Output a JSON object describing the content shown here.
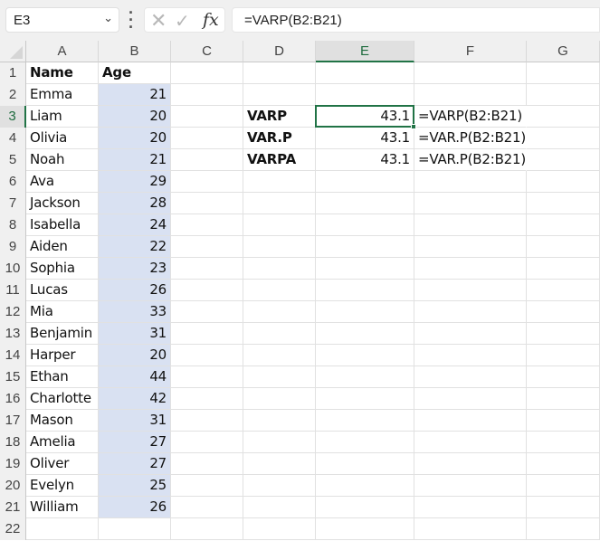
{
  "formula_bar": {
    "name_box": "E3",
    "formula": "=VARP(B2:B21)",
    "icons": [
      "chevron-down-icon",
      "more-options-icon",
      "cancel-icon",
      "enter-icon",
      "insert-function-icon"
    ]
  },
  "columns": [
    "A",
    "B",
    "C",
    "D",
    "E",
    "F",
    "G"
  ],
  "selected_column": "E",
  "selected_row": 3,
  "rows": [
    1,
    2,
    3,
    4,
    5,
    6,
    7,
    8,
    9,
    10,
    11,
    12,
    13,
    14,
    15,
    16,
    17,
    18,
    19,
    20,
    21,
    22
  ],
  "headers": {
    "name": "Name",
    "age": "Age"
  },
  "people": [
    {
      "name": "Emma",
      "age": 21
    },
    {
      "name": "Liam",
      "age": 20
    },
    {
      "name": "Olivia",
      "age": 20
    },
    {
      "name": "Noah",
      "age": 21
    },
    {
      "name": "Ava",
      "age": 29
    },
    {
      "name": "Jackson",
      "age": 28
    },
    {
      "name": "Isabella",
      "age": 24
    },
    {
      "name": "Aiden",
      "age": 22
    },
    {
      "name": "Sophia",
      "age": 23
    },
    {
      "name": "Lucas",
      "age": 26
    },
    {
      "name": "Mia",
      "age": 33
    },
    {
      "name": "Benjamin",
      "age": 31
    },
    {
      "name": "Harper",
      "age": 20
    },
    {
      "name": "Ethan",
      "age": 44
    },
    {
      "name": "Charlotte",
      "age": 42
    },
    {
      "name": "Mason",
      "age": 31
    },
    {
      "name": "Amelia",
      "age": 27
    },
    {
      "name": "Oliver",
      "age": 27
    },
    {
      "name": "Evelyn",
      "age": 25
    },
    {
      "name": "William",
      "age": 26
    }
  ],
  "results": [
    {
      "label": "VARP",
      "value": "43.1",
      "formula": "=VARP(B2:B21)"
    },
    {
      "label": "VAR.P",
      "value": "43.1",
      "formula": "=VAR.P(B2:B21)"
    },
    {
      "label": "VARPA",
      "value": "43.1",
      "formula": "=VAR.P(B2:B21)"
    }
  ]
}
